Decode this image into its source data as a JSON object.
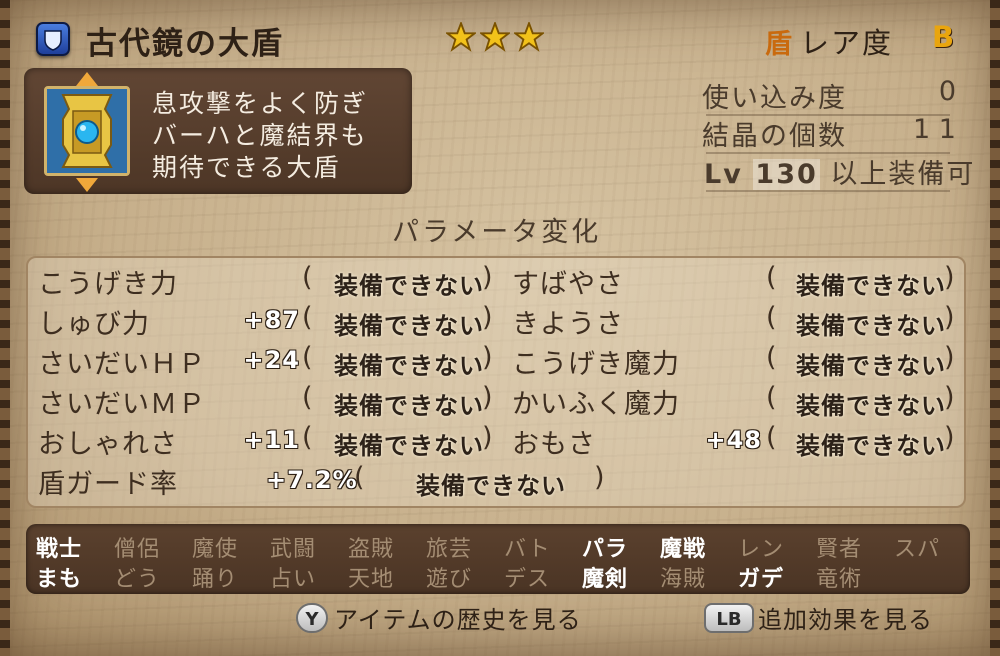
{
  "header": {
    "item_name": "古代鏡の大盾",
    "stars": 3,
    "category_icon": "盾",
    "rarity_label": "レア度",
    "rarity_grade": "B"
  },
  "item": {
    "icon": "golden-shield-icon",
    "description": [
      "息攻撃をよく防ぎ",
      "バーハと魔結界も",
      "期待できる大盾"
    ]
  },
  "info": {
    "usage_label": "使い込み度",
    "usage_value": "0",
    "crystal_label": "結晶の個数",
    "crystal_value": "1 1",
    "level_prefix": "Lv",
    "level_value": "130",
    "level_suffix": "以上装備可"
  },
  "params": {
    "section_title": "パラメータ変化",
    "equip_text": "装備できない",
    "left": [
      {
        "name": "こうげき力",
        "value": ""
      },
      {
        "name": "しゅび力",
        "value": "+87"
      },
      {
        "name": "さいだいＨＰ",
        "value": "+24"
      },
      {
        "name": "さいだいＭＰ",
        "value": ""
      },
      {
        "name": "おしゃれさ",
        "value": "+11"
      },
      {
        "name": "盾ガード率",
        "value": "+7.2%"
      }
    ],
    "right": [
      {
        "name": "すばやさ",
        "value": ""
      },
      {
        "name": "きようさ",
        "value": ""
      },
      {
        "name": "こうげき魔力",
        "value": ""
      },
      {
        "name": "かいふく魔力",
        "value": ""
      },
      {
        "name": "おもさ",
        "value": "+48"
      }
    ]
  },
  "jobs": {
    "row1": [
      {
        "label": "戦士",
        "on": true
      },
      {
        "label": "僧侶",
        "on": false
      },
      {
        "label": "魔使",
        "on": false
      },
      {
        "label": "武闘",
        "on": false
      },
      {
        "label": "盗賊",
        "on": false
      },
      {
        "label": "旅芸",
        "on": false
      },
      {
        "label": "バト",
        "on": false
      },
      {
        "label": "パラ",
        "on": true
      },
      {
        "label": "魔戦",
        "on": true
      },
      {
        "label": "レン",
        "on": false
      },
      {
        "label": "賢者",
        "on": false
      },
      {
        "label": "スパ",
        "on": false
      }
    ],
    "row2": [
      {
        "label": "まも",
        "on": true
      },
      {
        "label": "どう",
        "on": false
      },
      {
        "label": "踊り",
        "on": false
      },
      {
        "label": "占い",
        "on": false
      },
      {
        "label": "天地",
        "on": false
      },
      {
        "label": "遊び",
        "on": false
      },
      {
        "label": "デス",
        "on": false
      },
      {
        "label": "魔剣",
        "on": true
      },
      {
        "label": "海賊",
        "on": false
      },
      {
        "label": "ガデ",
        "on": true
      },
      {
        "label": "竜術",
        "on": false
      }
    ]
  },
  "footer": {
    "history_button": "Y",
    "history_label": "アイテムの歴史を見る",
    "effects_button": "LB",
    "effects_label": "追加効果を見る"
  },
  "colors": {
    "active_job": "#ffffff",
    "inactive_job": "#a48d73",
    "star": "#f2c21a",
    "rarity": "#e9a50e"
  }
}
